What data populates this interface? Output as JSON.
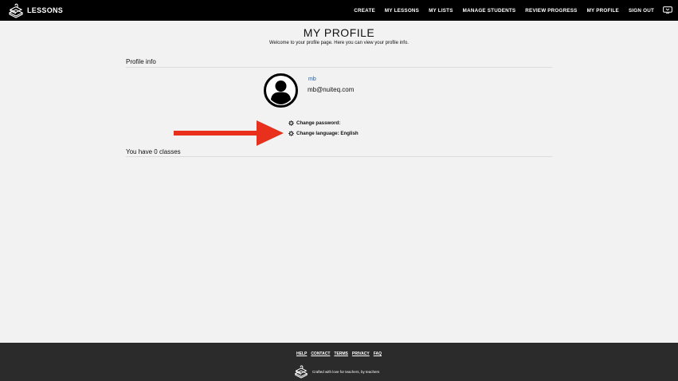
{
  "header": {
    "logo_text": "LESSONS",
    "nav": [
      "CREATE",
      "MY LESSONS",
      "MY LISTS",
      "MANAGE STUDENTS",
      "REVIEW PROGRESS",
      "MY PROFILE",
      "SIGN OUT"
    ],
    "tv_icon": "tv-icon"
  },
  "main": {
    "title": "MY PROFILE",
    "subtitle": "Welcome to your profile page. Here you can view your profile info.",
    "profile_section_title": "Profile info",
    "username": "mb",
    "email": "mb@nuiteq.com",
    "change_password_label": "Change password:",
    "change_language_label": "Change language: English",
    "classes_text": "You have 0 classes"
  },
  "annotation": {
    "arrow_color": "#e8301c"
  },
  "footer": {
    "links": [
      "HELP",
      "CONTACT",
      "TERMS",
      "PRIVACY",
      "FAQ"
    ],
    "tagline": "Crafted with love for teachers, by teachers"
  }
}
